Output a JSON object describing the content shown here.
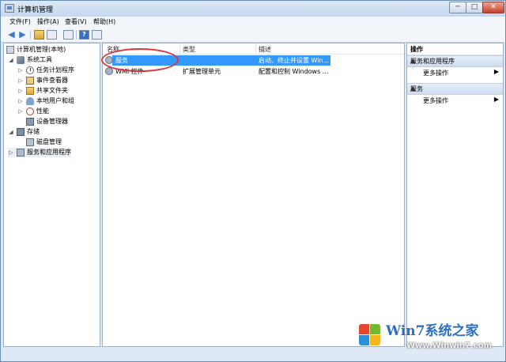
{
  "window": {
    "title": "计算机管理",
    "controls": {
      "minimize": "─",
      "maximize": "□",
      "close": "✕"
    }
  },
  "menu": [
    "文件(F)",
    "操作(A)",
    "查看(V)",
    "帮助(H)"
  ],
  "toolbar": {
    "icons": [
      "back-arrow-icon",
      "forward-arrow-icon",
      "up-folder-icon",
      "show-hide-tree-icon",
      "export-icon",
      "help-icon",
      "console-icon"
    ],
    "help_label": "?"
  },
  "tree": {
    "root": "计算机管理(本地)",
    "items": [
      {
        "label": "系统工具",
        "expander": "◢"
      },
      {
        "label": "任务计划程序",
        "expander": "▷"
      },
      {
        "label": "事件查看器",
        "expander": "▷"
      },
      {
        "label": "共享文件夹",
        "expander": "▷"
      },
      {
        "label": "本地用户和组",
        "expander": "▷"
      },
      {
        "label": "性能",
        "expander": "▷"
      },
      {
        "label": "设备管理器",
        "expander": ""
      },
      {
        "label": "存储",
        "expander": "◢"
      },
      {
        "label": "磁盘管理",
        "expander": ""
      },
      {
        "label": "服务和应用程序",
        "expander": "▷"
      }
    ]
  },
  "list": {
    "columns": [
      "名称",
      "类型",
      "描述"
    ],
    "rows": [
      {
        "name": "服务",
        "type": "",
        "desc": "启动、终止并设置 Win..."
      },
      {
        "name": "WMI 控件",
        "type": "扩展管理单元",
        "desc": "配置和控制 Windows ..."
      }
    ]
  },
  "actions": {
    "title": "操作",
    "sections": [
      {
        "header": "服务和应用程序",
        "more": "更多操作"
      },
      {
        "header": "服务",
        "more": "更多操作"
      }
    ],
    "collapse_glyph": "▲",
    "more_glyph": "▶"
  },
  "watermark": {
    "line1": "Win7系统之家",
    "line2": "Www.Winwin7.com"
  },
  "colors": {
    "selection": "#3399ff",
    "annotation_circle": "#d9363e",
    "window_frame": "#dfe9f5"
  }
}
